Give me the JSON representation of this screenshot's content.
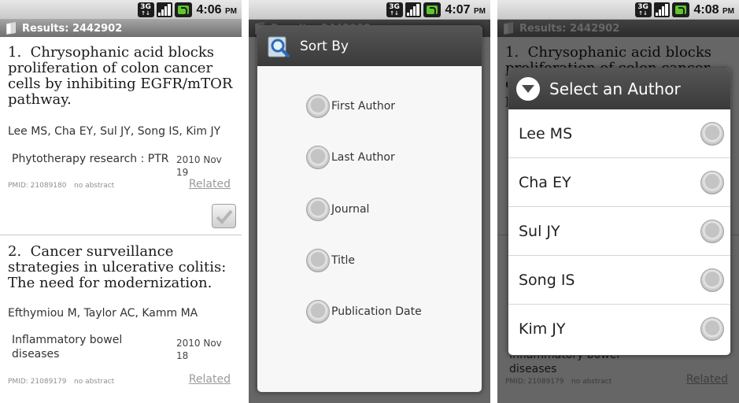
{
  "status": {
    "network": "3G",
    "screens": [
      {
        "time": "4:06",
        "ampm": "PM"
      },
      {
        "time": "4:07",
        "ampm": "PM"
      },
      {
        "time": "4:08",
        "ampm": "PM"
      }
    ]
  },
  "header": {
    "title": "Results: 2442902"
  },
  "results": [
    {
      "index": "1.",
      "title": "Chrysophanic acid blocks proliferation of colon cancer cells by inhibiting EGFR/mTOR pathway.",
      "authors": "Lee MS, Cha EY, Sul JY, Song IS, Kim JY",
      "journal": "Phytotherapy research : PTR",
      "date": "2010 Nov 19",
      "pmid": "PMID: 21089180",
      "abstract": "no abstract",
      "related": "Related"
    },
    {
      "index": "2.",
      "title": "Cancer surveillance strategies in ulcerative colitis: The need for modernization.",
      "authors": "Efthymiou M, Taylor AC, Kamm MA",
      "journal": "Inflammatory bowel diseases",
      "date": "2010 Nov 18",
      "pmid": "PMID: 21089179",
      "abstract": "no abstract",
      "related": "Related"
    }
  ],
  "sort_dialog": {
    "title": "Sort By",
    "options": [
      "First Author",
      "Last Author",
      "Journal",
      "Title",
      "Publication Date"
    ]
  },
  "author_dialog": {
    "title": "Select an Author",
    "authors": [
      "Lee MS",
      "Cha EY",
      "Sul JY",
      "Song IS",
      "Kim JY"
    ]
  },
  "colors": {
    "titlebar": "#8a8a8a",
    "dialog_header": "#474747",
    "battery": "#5fc72e"
  }
}
